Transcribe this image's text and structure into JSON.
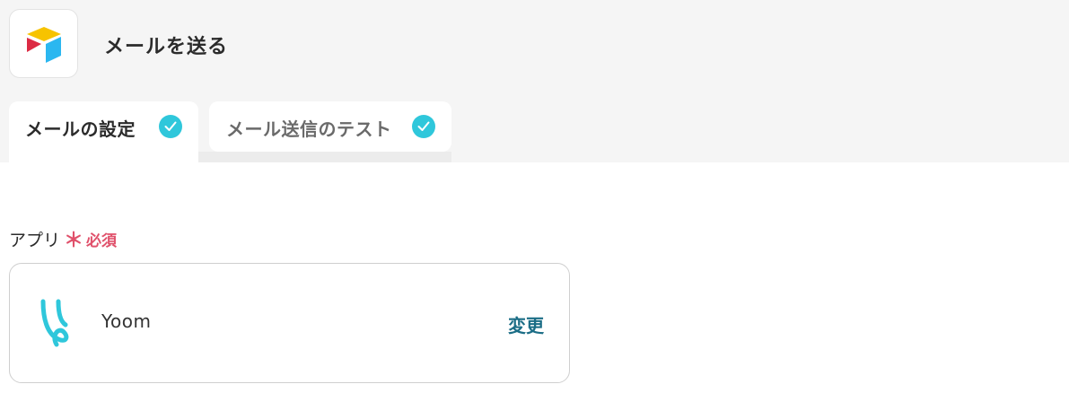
{
  "header": {
    "title": "メールを送る",
    "app_icon": "airtable-icon"
  },
  "tabs": [
    {
      "label": "メールの設定",
      "active": true,
      "status_icon": "check-circle-icon"
    },
    {
      "label": "メール送信のテスト",
      "active": false,
      "status_icon": "check-circle-icon"
    }
  ],
  "field": {
    "label": "アプリ",
    "required_mark": "＊",
    "required_text": "必須"
  },
  "app_card": {
    "app_name": "Yoom",
    "app_icon": "yoom-logo-icon",
    "change_label": "変更"
  },
  "colors": {
    "accent_check": "#2fc7db",
    "required": "#e0516b",
    "link": "#1b6d86",
    "header_bg": "#f5f5f5"
  }
}
